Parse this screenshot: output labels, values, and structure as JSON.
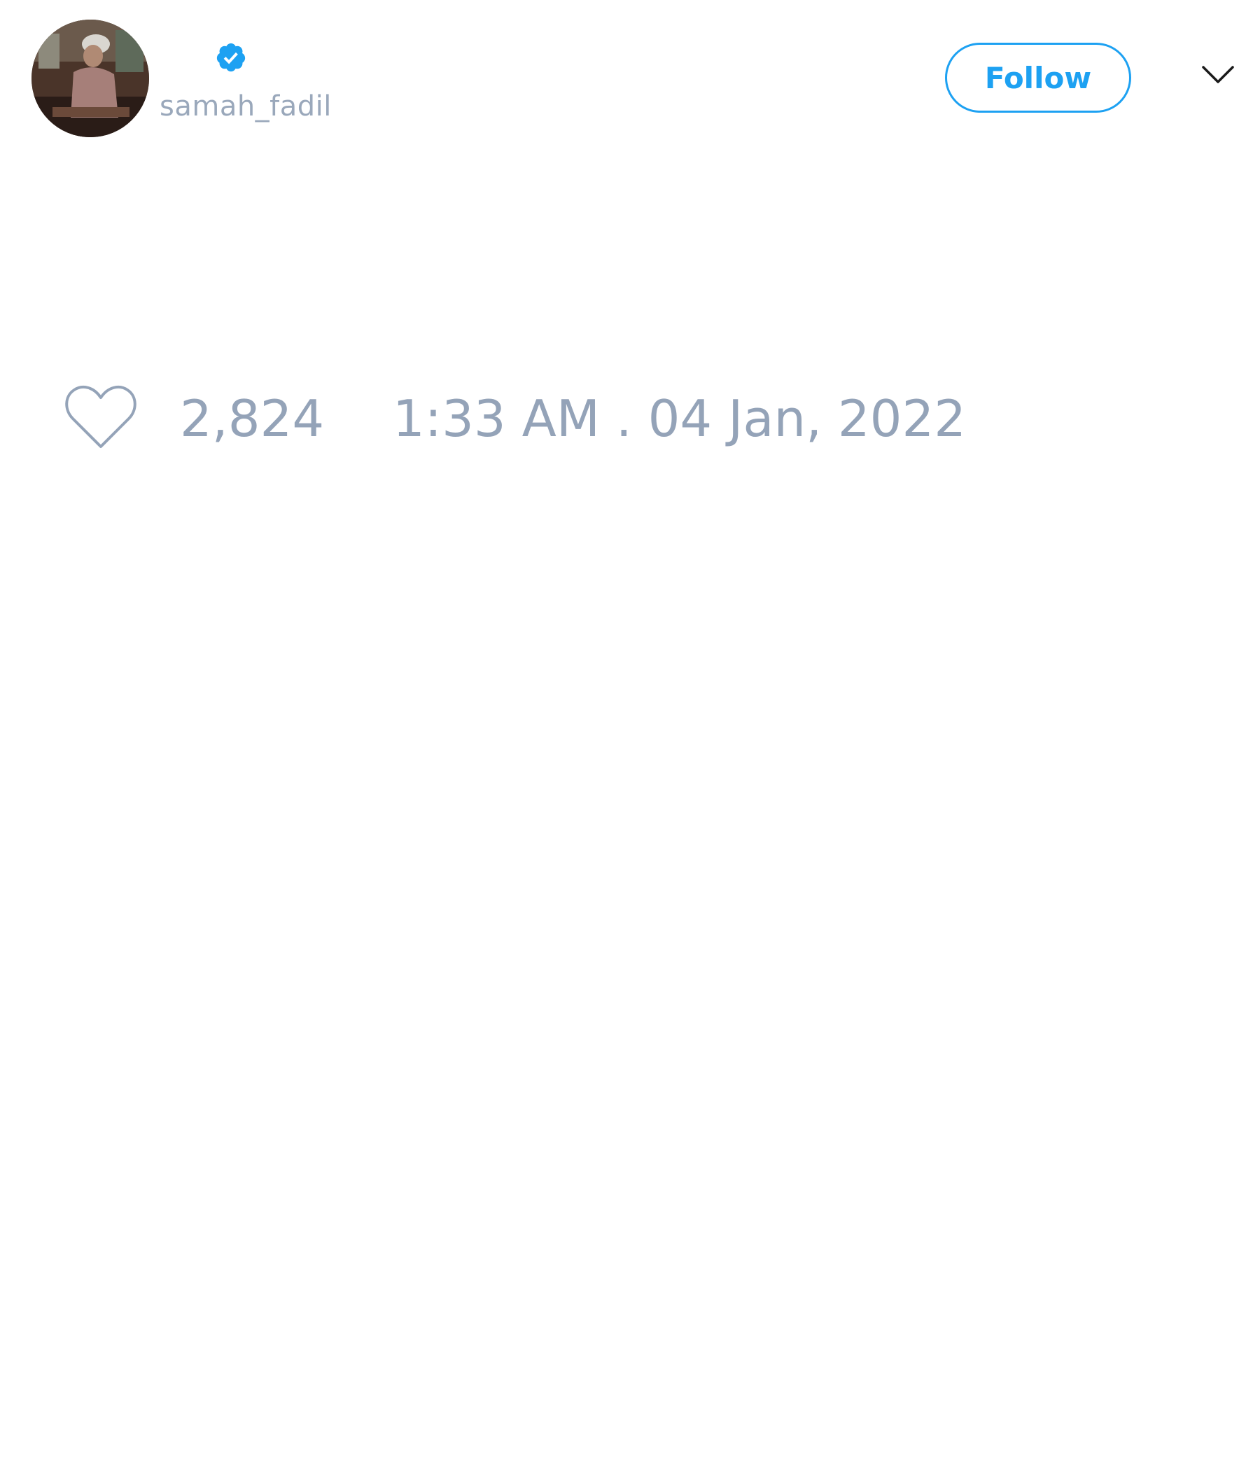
{
  "author": {
    "display_name": "",
    "handle": "samah_fadil",
    "verified": true,
    "avatar_icon": "profile-photo"
  },
  "actions": {
    "follow_label": "Follow",
    "menu_icon": "chevron-down-icon"
  },
  "stats": {
    "like_icon": "heart-outline-icon",
    "likes": "2,824",
    "timestamp": "1:33 AM . 04 Jan, 2022"
  },
  "colors": {
    "accent": "#1da1f2",
    "muted_text": "#94a3b8",
    "background": "#ffffff"
  }
}
